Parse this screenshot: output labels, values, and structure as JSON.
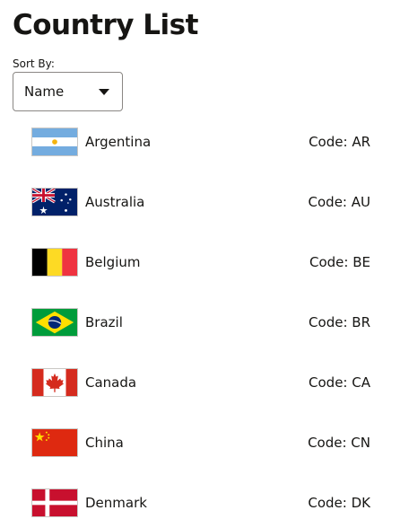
{
  "page": {
    "title": "Country List"
  },
  "sort": {
    "label": "Sort By:",
    "selected": "Name"
  },
  "code_prefix": "Code: ",
  "countries": [
    {
      "name": "Argentina",
      "code": "AR",
      "flag_icon": "argentina-flag-icon"
    },
    {
      "name": "Australia",
      "code": "AU",
      "flag_icon": "australia-flag-icon"
    },
    {
      "name": "Belgium",
      "code": "BE",
      "flag_icon": "belgium-flag-icon"
    },
    {
      "name": "Brazil",
      "code": "BR",
      "flag_icon": "brazil-flag-icon"
    },
    {
      "name": "Canada",
      "code": "CA",
      "flag_icon": "canada-flag-icon"
    },
    {
      "name": "China",
      "code": "CN",
      "flag_icon": "china-flag-icon"
    },
    {
      "name": "Denmark",
      "code": "DK",
      "flag_icon": "denmark-flag-icon"
    }
  ]
}
